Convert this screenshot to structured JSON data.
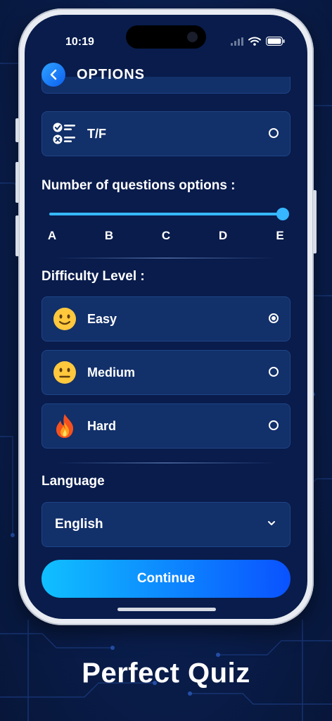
{
  "status_bar": {
    "time": "10:19"
  },
  "header": {
    "title": "OPTIONS"
  },
  "question_types": [
    {
      "label": "T/F",
      "icon": "checklist-icon",
      "selected": false
    }
  ],
  "questions_options": {
    "label": "Number of questions options :",
    "ticks": [
      "A",
      "B",
      "C",
      "D",
      "E"
    ],
    "selected_index": 4
  },
  "difficulty": {
    "label": "Difficulty Level :",
    "levels": [
      {
        "label": "Easy",
        "icon": "slightly-smiling-face-icon",
        "selected": true
      },
      {
        "label": "Medium",
        "icon": "neutral-face-icon",
        "selected": false
      },
      {
        "label": "Hard",
        "icon": "fire-icon",
        "selected": false
      }
    ]
  },
  "language": {
    "label": "Language",
    "selected": "English"
  },
  "continue_label": "Continue",
  "brand_text": "Perfect Quiz",
  "colors": {
    "accent": "#36b7ff",
    "button_start": "#10c0ff",
    "button_end": "#0a52ff",
    "card": "#12306a",
    "background": "#091c4c"
  }
}
